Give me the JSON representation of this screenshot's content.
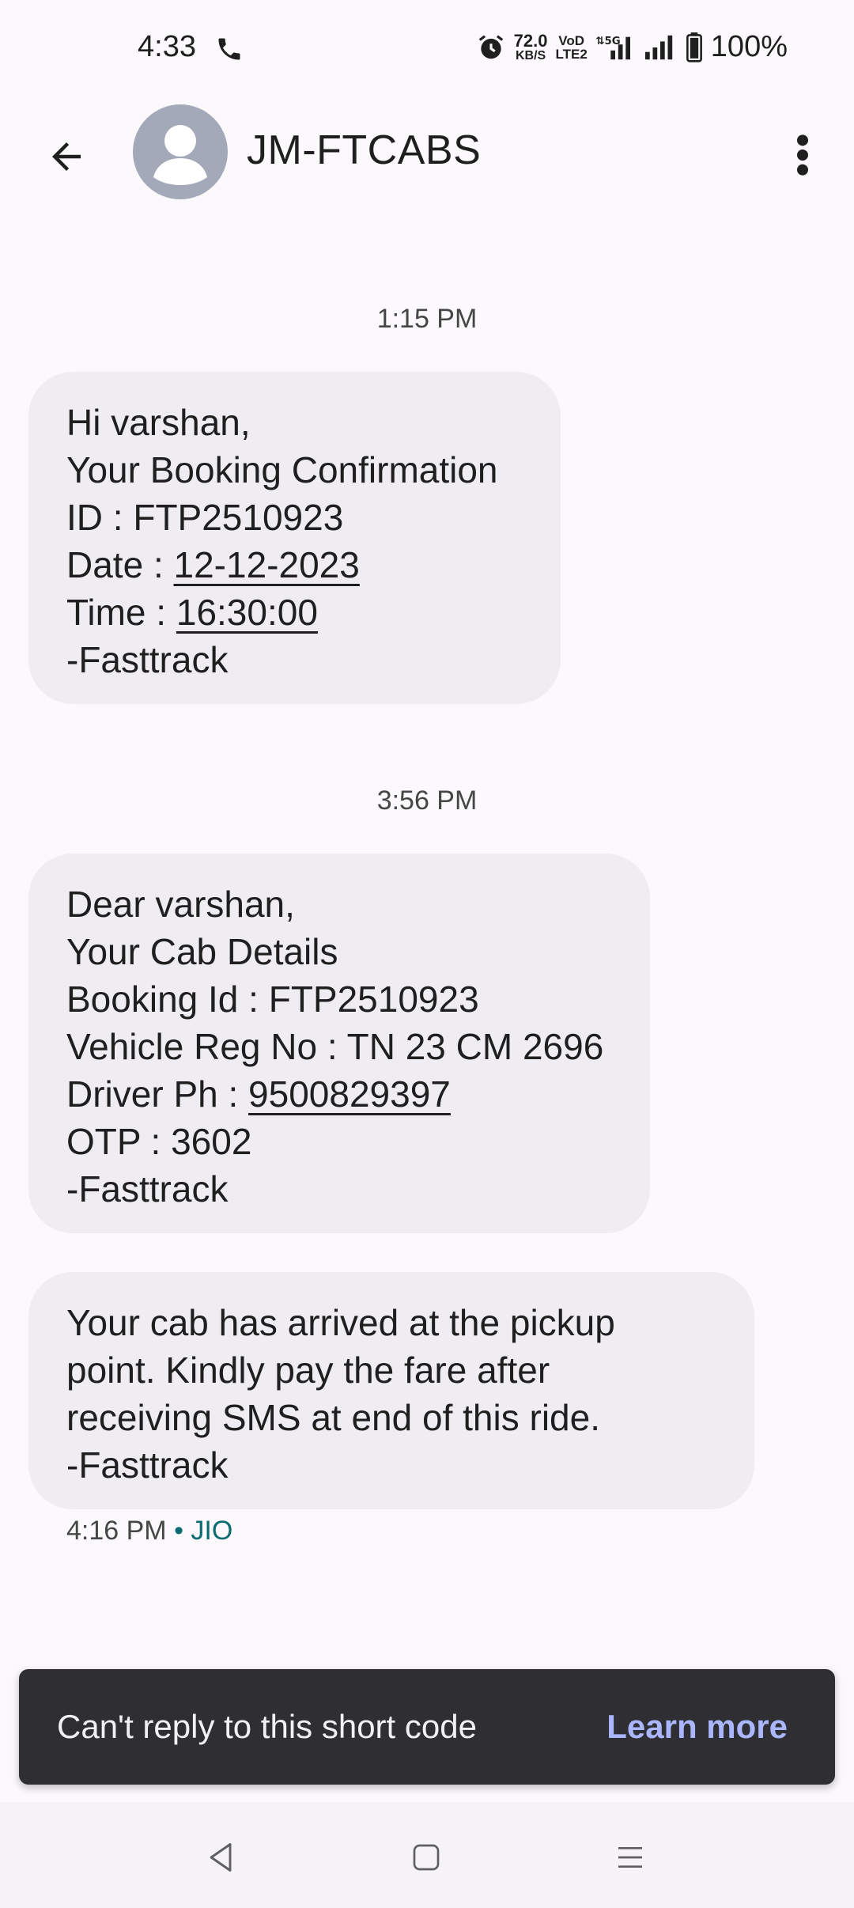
{
  "status_bar": {
    "time": "4:33",
    "net_speed": "72.0",
    "net_speed_unit": "KB/S",
    "volte": "VoD",
    "volte_sub": "LTE2",
    "network": "5G",
    "battery": "100%"
  },
  "app_bar": {
    "contact_name": "JM-FTCABS"
  },
  "messages": [
    {
      "timestamp": "1:15 PM",
      "lines": [
        "Hi varshan,",
        "Your Booking Confirmation",
        "ID : FTP2510923"
      ],
      "date_prefix": "Date : ",
      "date_value": "12-12-2023",
      "time_prefix": "Time : ",
      "time_value": "16:30:00",
      "signature": "-Fasttrack"
    },
    {
      "timestamp": "3:56 PM",
      "lines": [
        "Dear varshan,",
        "Your Cab Details",
        "Booking Id : FTP2510923",
        "Vehicle Reg No : TN 23 CM 2696"
      ],
      "phone_prefix": "Driver Ph : ",
      "phone_value": "9500829397",
      "otp": "OTP : 3602",
      "signature": "-Fasttrack"
    },
    {
      "lines": [
        "Your cab has arrived at the pickup",
        "point. Kindly pay the fare after",
        "receiving SMS at end of this ride.",
        "-Fasttrack"
      ],
      "meta_time": "4:16 PM",
      "meta_sep": " • ",
      "meta_carrier": "JIO"
    }
  ],
  "snackbar": {
    "text": "Can't reply to this short code",
    "action": "Learn more"
  },
  "icons": {
    "back": "arrow-left-icon",
    "more": "more-vert-icon",
    "avatar": "person-icon",
    "nav_back": "triangle-back-icon",
    "nav_home": "square-home-icon",
    "nav_recents": "menu-lines-icon"
  }
}
